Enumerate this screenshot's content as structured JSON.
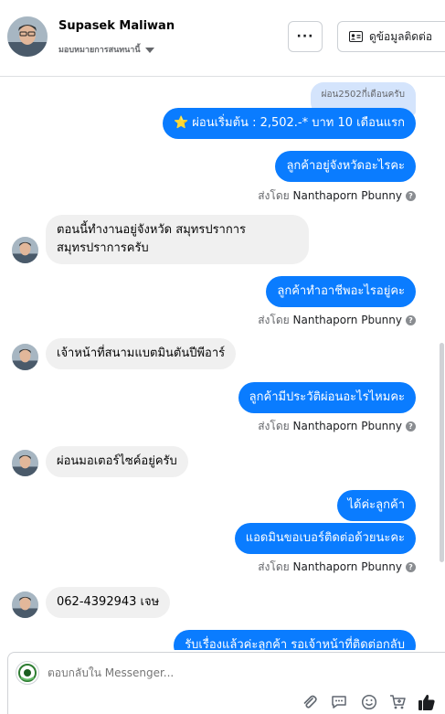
{
  "header": {
    "name": "Supasek Maliwan",
    "subtitle": "มอบหมายการสนทนานี้",
    "more_label": "···",
    "contact_label": "ดูข้อมูลติดต่อ"
  },
  "thread": {
    "quoted_text": "ผ่อน2502กี่เดือนครับ",
    "messages": [
      {
        "text": "⭐ ผ่อนเริ่มต้น : 2,502.-* บาท 10 เดือนแรก"
      },
      {
        "text": "ลูกค้าอยู่จังหวัดอะไรคะ"
      },
      {
        "text": "ตอนนี้ทำงานอยู่จังหวัด สมุทรปราการ สมุทรปราการครับ"
      },
      {
        "text": "ลูกค้าทำอาชีพอะไรอยู่คะ"
      },
      {
        "text": "เจ้าหน้าที่สนามแบตมินตันปีพีอาร์"
      },
      {
        "text": "ลูกค้ามีประวัติผ่อนอะไรไหมคะ"
      },
      {
        "text": "ผ่อนมอเตอร์ไซค์อยู่ครับ"
      },
      {
        "text": "ได้ค่ะลูกค้า"
      },
      {
        "text": "แอดมินขอเบอร์ติดต่อด้วยนะคะ"
      },
      {
        "text": "062-4392943  เจษ"
      },
      {
        "text": "รับเรื่องแล้วค่ะลูกค้า รอเจ้าหน้าที่ติดต่อกลับ"
      }
    ],
    "sent_by_prefix": "ส่งโดย",
    "sent_by_name": "Nanthaporn Pbunny",
    "help_mark": "?"
  },
  "composer": {
    "placeholder": "ตอบกลับใน Messenger..."
  },
  "colors": {
    "outgoing": "#0a7cff",
    "incoming": "#f0f0f0",
    "quoted": "#d4e4fc"
  },
  "icons": [
    "attachment-icon",
    "saved-reply-icon",
    "emoji-icon",
    "cart-icon",
    "like-icon",
    "more-icon",
    "contact-card-icon",
    "caret-down-icon"
  ]
}
